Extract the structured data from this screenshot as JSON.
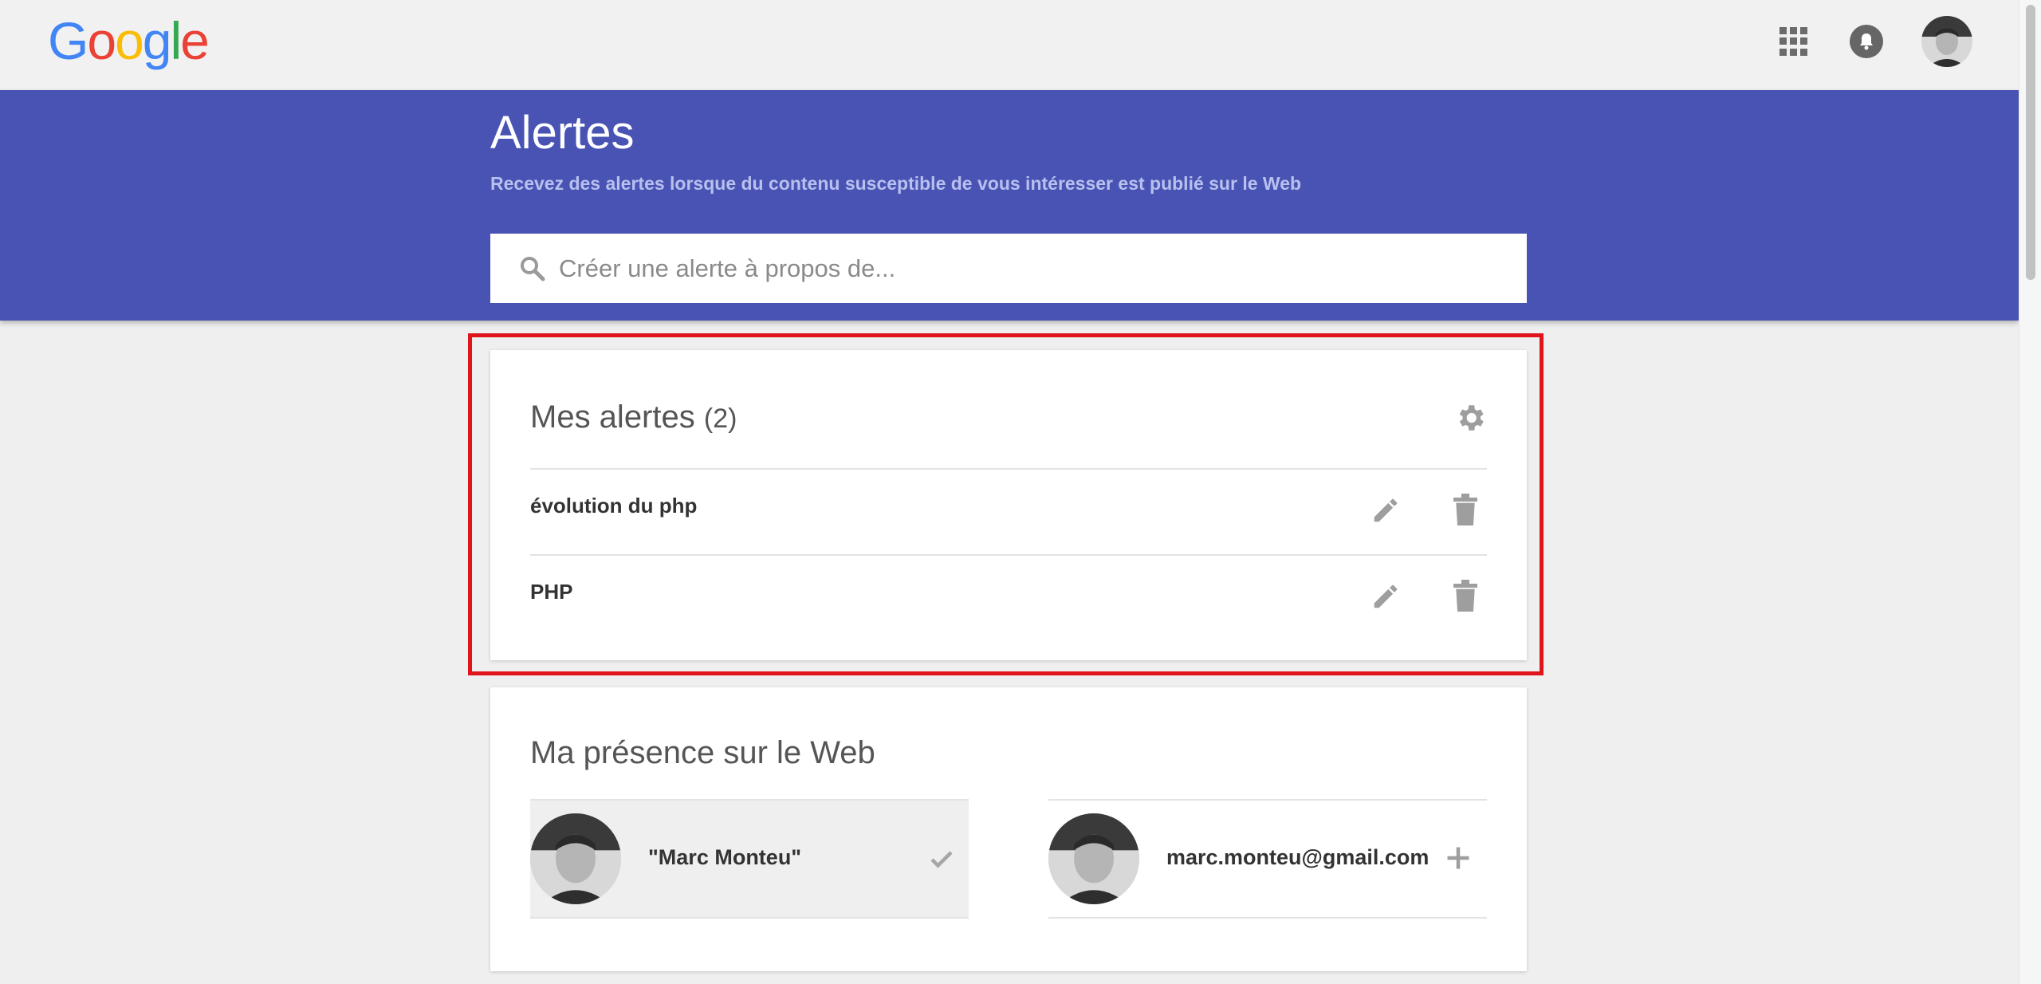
{
  "logo": {
    "letters": [
      "G",
      "o",
      "o",
      "g",
      "l",
      "e"
    ],
    "colors": [
      "#4285F4",
      "#EA4335",
      "#FBBC05",
      "#4285F4",
      "#34A853",
      "#EA4335"
    ]
  },
  "topbar": {
    "icons": [
      "apps-grid-icon",
      "notifications-bell-icon",
      "account-avatar"
    ]
  },
  "banner": {
    "title": "Alertes",
    "subtitle": "Recevez des alertes lorsque du contenu susceptible de vous intéresser est publié sur le Web",
    "background": "#4853b3"
  },
  "search": {
    "placeholder": "Créer une alerte à propos de..."
  },
  "alerts": {
    "title": "Mes alertes",
    "count": "(2)",
    "items": [
      {
        "label": "évolution du php"
      },
      {
        "label": "PHP"
      }
    ],
    "highlight_color": "#e0141c"
  },
  "presence": {
    "title": "Ma présence sur le Web",
    "items": [
      {
        "label": "\"Marc Monteu\"",
        "action": "check-icon",
        "selected": true
      },
      {
        "label": "marc.monteu@gmail.com",
        "action": "plus-icon",
        "selected": false
      }
    ]
  }
}
